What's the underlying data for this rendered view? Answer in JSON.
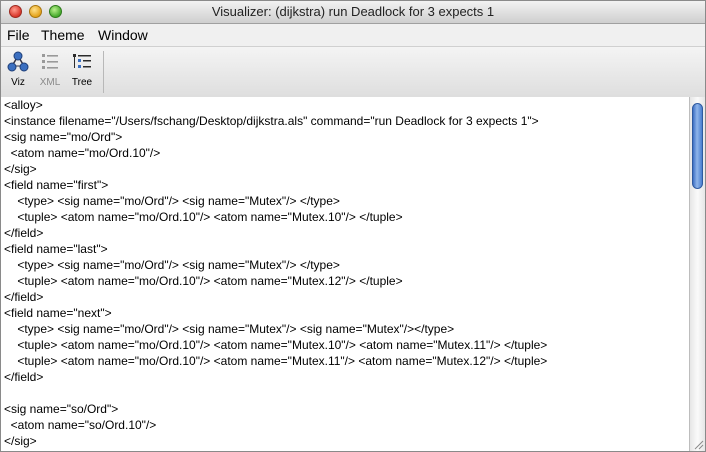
{
  "window": {
    "title": "Visualizer: (dijkstra) run Deadlock for 3 expects 1"
  },
  "menu": [
    "File",
    "Theme",
    "Window"
  ],
  "toolbar": [
    {
      "label": "Viz",
      "icon": "viz-graph-icon",
      "enabled": true
    },
    {
      "label": "XML",
      "icon": "xml-list-icon",
      "enabled": false
    },
    {
      "label": "Tree",
      "icon": "tree-list-icon",
      "enabled": true
    }
  ],
  "editor": {
    "lines": [
      "<alloy>",
      "<instance filename=\"/Users/fschang/Desktop/dijkstra.als\" command=\"run Deadlock for 3 expects 1\">",
      "<sig name=\"mo/Ord\">",
      "  <atom name=\"mo/Ord.10\"/>",
      "</sig>",
      "<field name=\"first\">",
      "    <type> <sig name=\"mo/Ord\"/> <sig name=\"Mutex\"/> </type>",
      "    <tuple> <atom name=\"mo/Ord.10\"/> <atom name=\"Mutex.10\"/> </tuple>",
      "</field>",
      "<field name=\"last\">",
      "    <type> <sig name=\"mo/Ord\"/> <sig name=\"Mutex\"/> </type>",
      "    <tuple> <atom name=\"mo/Ord.10\"/> <atom name=\"Mutex.12\"/> </tuple>",
      "</field>",
      "<field name=\"next\">",
      "    <type> <sig name=\"mo/Ord\"/> <sig name=\"Mutex\"/> <sig name=\"Mutex\"/></type>",
      "    <tuple> <atom name=\"mo/Ord.10\"/> <atom name=\"Mutex.10\"/> <atom name=\"Mutex.11\"/> </tuple>",
      "    <tuple> <atom name=\"mo/Ord.10\"/> <atom name=\"Mutex.11\"/> <atom name=\"Mutex.12\"/> </tuple>",
      "</field>",
      "",
      "<sig name=\"so/Ord\">",
      "  <atom name=\"so/Ord.10\"/>",
      "</sig>"
    ]
  },
  "scrollbar": {
    "position": 0.0,
    "visible_fraction": 0.25
  }
}
